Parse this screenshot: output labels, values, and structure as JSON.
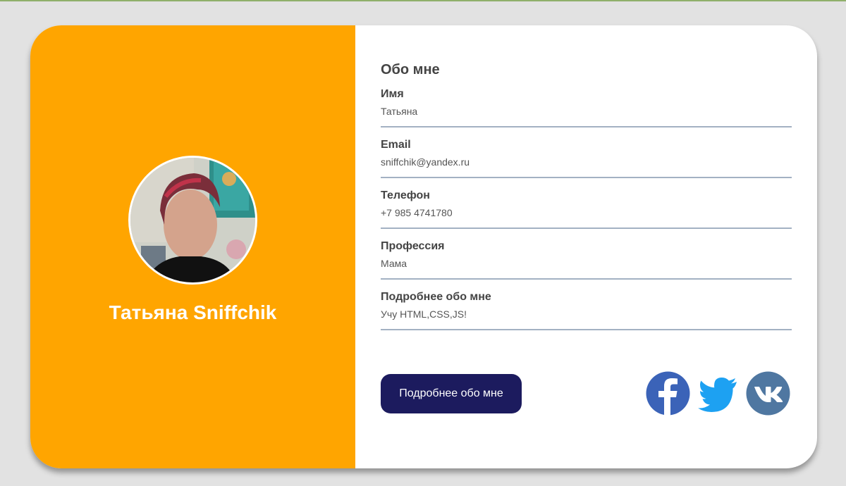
{
  "profile": {
    "name": "Татьяна Sniffchik",
    "accent_color": "#ffa500"
  },
  "about": {
    "title": "Обо мне",
    "fields": [
      {
        "label": "Имя",
        "value": "Татьяна"
      },
      {
        "label": "Email",
        "value": "sniffchik@yandex.ru"
      },
      {
        "label": "Телефон",
        "value": "+7 985 4741780"
      },
      {
        "label": "Профессия",
        "value": "Мама"
      },
      {
        "label": "Подробнее обо мне",
        "value": "Учу HTML,CSS,JS!"
      }
    ]
  },
  "actions": {
    "more_label": "Подробнее обо мне",
    "button_color": "#1c1b5e"
  },
  "social": [
    {
      "icon": "facebook-icon",
      "color": "#3b63b8"
    },
    {
      "icon": "twitter-icon",
      "color": "#1da1f2"
    },
    {
      "icon": "vk-icon",
      "color": "#4f77a1"
    }
  ]
}
